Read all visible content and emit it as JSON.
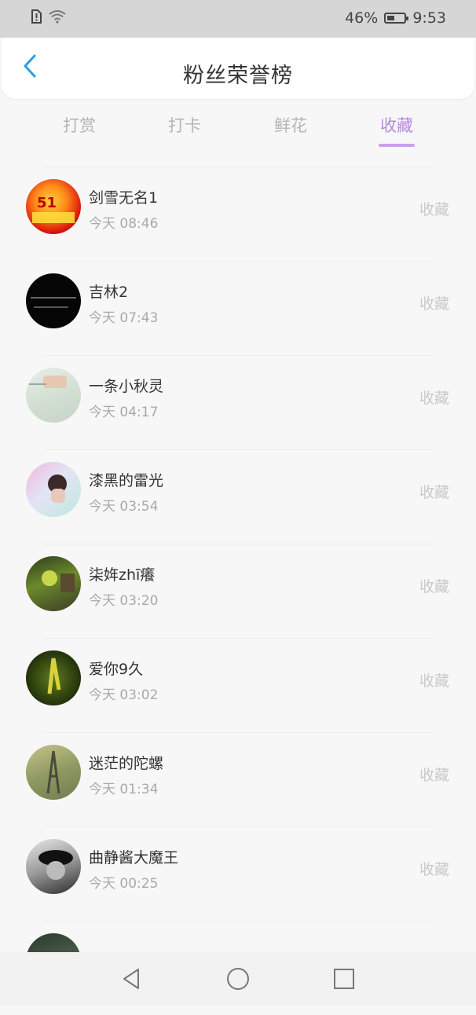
{
  "status": {
    "battery": "46%",
    "battery_level": 0.46,
    "time": "9:53",
    "icons": [
      "sim-alert-icon",
      "wifi-icon",
      "battery-icon"
    ]
  },
  "header": {
    "title": "粉丝荣誉榜",
    "back_icon": "chevron-left-icon"
  },
  "tabs": [
    {
      "label": "打赏",
      "active": false
    },
    {
      "label": "打卡",
      "active": false
    },
    {
      "label": "鲜花",
      "active": false
    },
    {
      "label": "收藏",
      "active": true
    }
  ],
  "accent_color": "#b68ad9",
  "list": [
    {
      "name": "剑雪无名1",
      "time": "今天 08:46",
      "action": "收藏"
    },
    {
      "name": "吉林2",
      "time": "今天 07:43",
      "action": "收藏"
    },
    {
      "name": "一条小秋灵",
      "time": "今天 04:17",
      "action": "收藏"
    },
    {
      "name": "漆黑的雷光",
      "time": "今天 03:54",
      "action": "收藏"
    },
    {
      "name": "柒姩zhī癢",
      "time": "今天 03:20",
      "action": "收藏"
    },
    {
      "name": "爱你9久",
      "time": "今天 03:02",
      "action": "收藏"
    },
    {
      "name": "迷茫的陀螺",
      "time": "今天 01:34",
      "action": "收藏"
    },
    {
      "name": "曲静酱大魔王",
      "time": "今天 00:25",
      "action": "收藏"
    }
  ],
  "navbar": {
    "buttons": [
      "back-triangle-icon",
      "home-circle-icon",
      "recents-square-icon"
    ]
  }
}
